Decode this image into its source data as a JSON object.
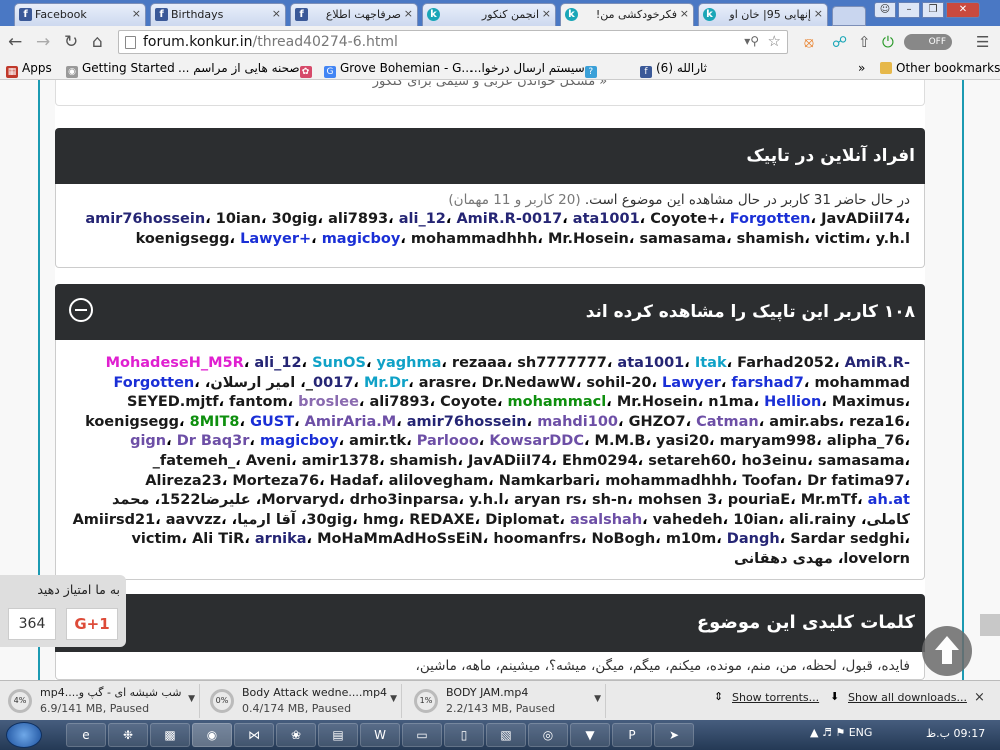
{
  "browser": {
    "tabs": [
      {
        "title": "Facebook",
        "icon": "facebook-icon",
        "active": false
      },
      {
        "title": "Birthdays",
        "icon": "facebook-icon",
        "active": false
      },
      {
        "title": "صرفاجهت اطلاع",
        "icon": "facebook-icon",
        "active": false
      },
      {
        "title": "انجمن کنکور",
        "icon": "konkur-icon",
        "active": false
      },
      {
        "title": "فکرخودکشی من!",
        "icon": "konkur-icon",
        "active": true
      },
      {
        "title": "إنهایی 95| خان او",
        "icon": "konkur-icon",
        "active": false
      }
    ],
    "close_glyph": "×",
    "url_host": "forum.konkur.in",
    "url_path": "/thread40274-6.html",
    "toggle_label": "OFF",
    "bookmarks": [
      {
        "label": "Apps",
        "icon": "apps-grid-icon"
      },
      {
        "label": "Getting Started",
        "icon": "getting-started-icon"
      },
      {
        "label": "صحنه هایی از مراسم ...",
        "icon": "site-icon"
      },
      {
        "label": "Grove Bohemian - G...",
        "icon": "google-icon"
      },
      {
        "label": "سیستم ارسال درخوا...",
        "icon": "help-icon"
      },
      {
        "label": "(6) ثارالله",
        "icon": "facebook-icon"
      }
    ],
    "bookmarks_overflow": "»",
    "other_bookmarks": "Other bookmarks"
  },
  "page": {
    "top_link": "« مشکل خواندن عربی و شیمی برای کنکور",
    "online": {
      "title": "افراد آنلاین در تاپیک",
      "summary": "در حال حاضر 31 کاربر در حال مشاهده این موضوع است.",
      "summary_detail": "(20 کاربر و 11 مهمان)",
      "users": [
        {
          "name": "amir76hossein",
          "color": "navy"
        },
        {
          "name": "10ian",
          "color": "default"
        },
        {
          "name": "30gig",
          "color": "default"
        },
        {
          "name": "ali7893",
          "color": "default"
        },
        {
          "name": "ali_12",
          "color": "navy"
        },
        {
          "name": "AmiR.R-0017",
          "color": "navy"
        },
        {
          "name": "ata1001",
          "color": "navy"
        },
        {
          "name": "Coyote+",
          "color": "default"
        },
        {
          "name": "Forgotten",
          "color": "blue"
        },
        {
          "name": "JavADiiI74",
          "color": "default"
        },
        {
          "name": "koenigsegg",
          "color": "default"
        },
        {
          "name": "Lawyer+",
          "color": "blue"
        },
        {
          "name": "magicboy",
          "color": "blue"
        },
        {
          "name": "mohammadhhh",
          "color": "default"
        },
        {
          "name": "Mr.Hosein",
          "color": "default"
        },
        {
          "name": "samasama",
          "color": "default"
        },
        {
          "name": "shamish",
          "color": "default"
        },
        {
          "name": "victim",
          "color": "default"
        },
        {
          "name": "y.h.l",
          "color": "default"
        }
      ]
    },
    "viewers": {
      "title": "۱۰۸ کاربر این تاپیک را مشاهده کرده اند",
      "users": [
        {
          "name": "MohadeseH_M5R",
          "color": "magenta"
        },
        {
          "name": "ali_12",
          "color": "navy"
        },
        {
          "name": "SunOS",
          "color": "teal"
        },
        {
          "name": "yaghma",
          "color": "teal"
        },
        {
          "name": "rezaaa",
          "color": "default"
        },
        {
          "name": "sh7777777",
          "color": "default"
        },
        {
          "name": "ata1001",
          "color": "navy"
        },
        {
          "name": "Itak",
          "color": "teal"
        },
        {
          "name": "Farhad2052",
          "color": "default"
        },
        {
          "name": "AmiR.R-0017",
          "color": "navy"
        },
        {
          "name": "Mr.Dr",
          "color": "teal"
        },
        {
          "name": "arasre",
          "color": "default"
        },
        {
          "name": "Dr.NedawW",
          "color": "default"
        },
        {
          "name": "sohil-20",
          "color": "default"
        },
        {
          "name": "Lawyer",
          "color": "blue"
        },
        {
          "name": "farshad7",
          "color": "blue"
        },
        {
          "name": "mohammad_",
          "color": "default"
        },
        {
          "name": "امیر ارسلان",
          "color": "default"
        },
        {
          "name": "Forgotten",
          "color": "blue"
        },
        {
          "name": "SEYED.mjtf",
          "color": "default"
        },
        {
          "name": "fantom",
          "color": "default"
        },
        {
          "name": "broslee",
          "color": "lpurple"
        },
        {
          "name": "ali7893",
          "color": "default"
        },
        {
          "name": "Coyote",
          "color": "default"
        },
        {
          "name": "mohammacl",
          "color": "green"
        },
        {
          "name": "Mr.Hosein",
          "color": "default"
        },
        {
          "name": "n1ma",
          "color": "default"
        },
        {
          "name": "Hellion",
          "color": "blue"
        },
        {
          "name": "Maximus",
          "color": "default"
        },
        {
          "name": "koenigsegg",
          "color": "default"
        },
        {
          "name": "8MIT8",
          "color": "green"
        },
        {
          "name": "GUST",
          "color": "blue"
        },
        {
          "name": "AmirAria.M",
          "color": "purple"
        },
        {
          "name": "amir76hossein",
          "color": "navy"
        },
        {
          "name": "mahdi100",
          "color": "purple"
        },
        {
          "name": "GHZO7",
          "color": "default"
        },
        {
          "name": "Catman",
          "color": "purple"
        },
        {
          "name": "amir.abs",
          "color": "default"
        },
        {
          "name": "reza16",
          "color": "default"
        },
        {
          "name": "gign",
          "color": "purple"
        },
        {
          "name": "Dr Baq3r",
          "color": "purple"
        },
        {
          "name": "magicboy",
          "color": "blue"
        },
        {
          "name": "amir.tk",
          "color": "default"
        },
        {
          "name": "Parlooo",
          "color": "purple"
        },
        {
          "name": "KowsarDDC",
          "color": "purple"
        },
        {
          "name": "M.M.B",
          "color": "default"
        },
        {
          "name": "yasi20",
          "color": "default"
        },
        {
          "name": "maryam998",
          "color": "default"
        },
        {
          "name": "alipha_76",
          "color": "default"
        },
        {
          "name": "_fatemeh_",
          "color": "default"
        },
        {
          "name": "Aveni",
          "color": "default"
        },
        {
          "name": "amir1378",
          "color": "default"
        },
        {
          "name": "shamish",
          "color": "default"
        },
        {
          "name": "JavADiiI74",
          "color": "default"
        },
        {
          "name": "Ehm0294",
          "color": "default"
        },
        {
          "name": "setareh60",
          "color": "default"
        },
        {
          "name": "ho3einu",
          "color": "default"
        },
        {
          "name": "samasama",
          "color": "default"
        },
        {
          "name": "Alireza23",
          "color": "default"
        },
        {
          "name": "Morteza76",
          "color": "default"
        },
        {
          "name": "Hadaf",
          "color": "default"
        },
        {
          "name": "alilovegham",
          "color": "default"
        },
        {
          "name": "Namkarbari",
          "color": "default"
        },
        {
          "name": "mohammadhhh",
          "color": "default"
        },
        {
          "name": "Toofan",
          "color": "default"
        },
        {
          "name": "Dr fatima97",
          "color": "default"
        },
        {
          "name": "Morvaryd",
          "color": "default"
        },
        {
          "name": "drho3inparsa",
          "color": "default"
        },
        {
          "name": "y.h.l",
          "color": "default"
        },
        {
          "name": "aryan rs",
          "color": "default"
        },
        {
          "name": "sh-n",
          "color": "default"
        },
        {
          "name": "mohsen 3",
          "color": "default"
        },
        {
          "name": "pouriaE",
          "color": "default"
        },
        {
          "name": "Mr.mTf",
          "color": "default"
        },
        {
          "name": "ah.at",
          "color": "blue"
        },
        {
          "name": "علیرضا1522",
          "color": "default"
        },
        {
          "name": "محمد کاملی",
          "color": "default"
        },
        {
          "name": "30gig",
          "color": "default"
        },
        {
          "name": "hmg",
          "color": "default"
        },
        {
          "name": "REDAXE",
          "color": "default"
        },
        {
          "name": "Diplomat",
          "color": "default"
        },
        {
          "name": "asalshah",
          "color": "purple"
        },
        {
          "name": "vahedeh",
          "color": "default"
        },
        {
          "name": "10ian",
          "color": "default"
        },
        {
          "name": "ali.rainy",
          "color": "default"
        },
        {
          "name": "آقا ارمیا",
          "color": "default"
        },
        {
          "name": "Amiirsd21",
          "color": "default"
        },
        {
          "name": "aavvzz",
          "color": "default"
        },
        {
          "name": "victim",
          "color": "default"
        },
        {
          "name": "Ali TiR",
          "color": "default"
        },
        {
          "name": "arnika",
          "color": "navy"
        },
        {
          "name": "MoHaMmAdHoSsEiN",
          "color": "default"
        },
        {
          "name": "hoomanfrs",
          "color": "default"
        },
        {
          "name": "NoBogh",
          "color": "default"
        },
        {
          "name": "m10m",
          "color": "default"
        },
        {
          "name": "Dangh",
          "color": "navy"
        },
        {
          "name": "Sardar sedghi",
          "color": "default"
        },
        {
          "name": "lovelorn",
          "color": "default"
        },
        {
          "name": "مهدی دهقانی",
          "color": "default"
        }
      ]
    },
    "keywords": {
      "title": "کلمات کلیدی این موضوع",
      "text": "فایده، قبول، لحظه، من، منم، مونده، میکنم، میگم، میگن، میشه؟، میشینم، ماهه، ماشین،"
    }
  },
  "share": {
    "label": "به ما امتیاز دهید",
    "count": "364",
    "button": "G+1"
  },
  "downloads": {
    "items": [
      {
        "percent": "4%",
        "name": "شب شیشه ای - گپ و....mp4",
        "status": "6.9/141 MB, Paused"
      },
      {
        "percent": "0%",
        "name": "Body Attack wedne....mp4",
        "status": "0.4/174 MB, Paused"
      },
      {
        "percent": "1%",
        "name": "BODY JAM.mp4",
        "status": "2.2/143 MB, Paused"
      }
    ],
    "show_torrents": "Show torrents...",
    "show_all": "Show all downloads...",
    "close": "×"
  },
  "taskbar": {
    "lang": "ENG",
    "clock": "09:17 ب.ظ"
  },
  "colors": {
    "default": "#1a1a1a",
    "blue": "#1a2fd6",
    "navy": "#252574",
    "green": "#0e8f0e",
    "teal": "#10a2c7",
    "magenta": "#e020d0",
    "purple": "#6d4fa6",
    "lpurple": "#8a6bb0",
    "header_bg": "#2c2e30",
    "accent_rule": "#1c9ab2"
  }
}
